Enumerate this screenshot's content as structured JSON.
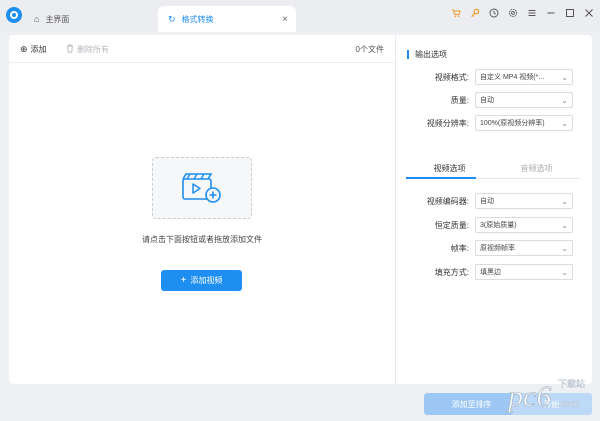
{
  "titlebar": {
    "home_tab": "主界面",
    "active_tab": "格式转换",
    "close_glyph": "×",
    "icons": [
      "cart-icon",
      "key-icon",
      "history-icon",
      "settings-icon",
      "menu-icon",
      "minimize-icon",
      "maximize-icon",
      "close-icon"
    ]
  },
  "toolbar": {
    "add_label": "添加",
    "remove_all_label": "删除所有",
    "file_count": "0个文件"
  },
  "main": {
    "drop_hint": "请点击下面按钮或者拖放添加文件",
    "add_video_label": "添加视频"
  },
  "output": {
    "section_title": "输出选项",
    "rows": [
      {
        "label": "视频格式:",
        "value": "自定义 MP4 视频(*..."
      },
      {
        "label": "质量:",
        "value": "自动"
      },
      {
        "label": "视频分辨率:",
        "value": "100%(原视频分辨率)"
      }
    ],
    "tabs": {
      "video": "视频选项",
      "audio": "音频选项"
    },
    "video_rows": [
      {
        "label": "视频编码器:",
        "value": "自动"
      },
      {
        "label": "恒定质量:",
        "value": "3(原始质量)"
      },
      {
        "label": "帧率:",
        "value": "原视频帧率"
      },
      {
        "label": "填充方式:",
        "value": "填黑边"
      }
    ]
  },
  "bottom": {
    "add_to_list_label": "添加至排序",
    "start_label": "开始"
  },
  "watermark": {
    "text": "pc6",
    "sub": "下载站",
    "domain": ".com"
  },
  "colors": {
    "accent": "#1e8ef0",
    "accent_light": "#9ec8f4",
    "toolbar_orange": "#f29a2e"
  }
}
